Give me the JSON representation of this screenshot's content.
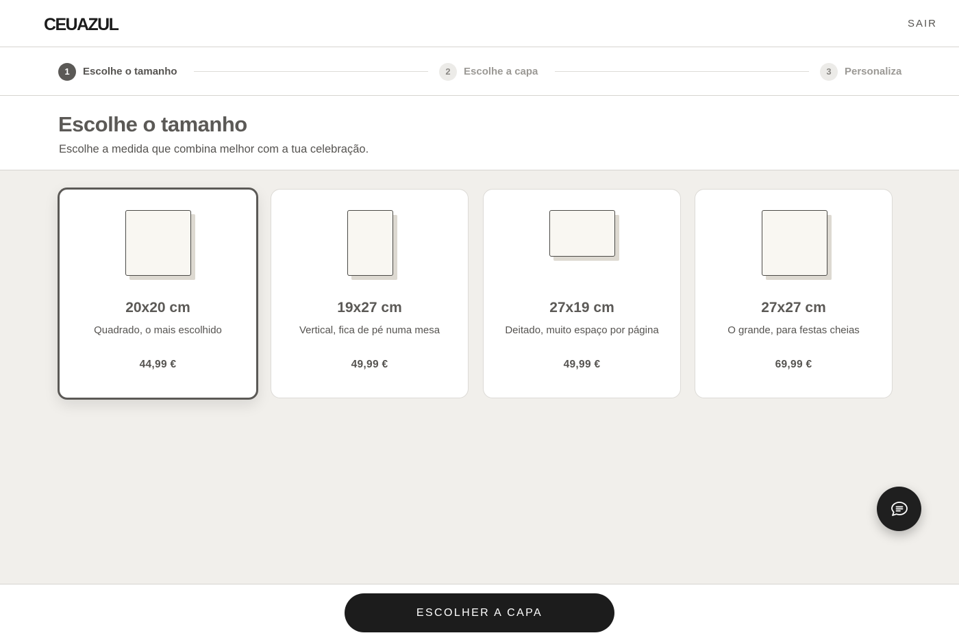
{
  "header": {
    "logo": "CEUAZUL",
    "exit_label": "SAIR"
  },
  "stepper": {
    "steps": [
      {
        "number": "1",
        "label": "Escolhe o tamanho",
        "state": "active"
      },
      {
        "number": "2",
        "label": "Escolhe a capa",
        "state": "inactive"
      },
      {
        "number": "3",
        "label": "Personaliza",
        "state": "inactive"
      }
    ]
  },
  "intro": {
    "title": "Escolhe o tamanho",
    "subtitle": "Escolhe a medida que combina melhor com a tua celebração."
  },
  "sizes": [
    {
      "size": "20x20 cm",
      "description": "Quadrado, o mais escolhido",
      "price": "44,99 €",
      "selected": true,
      "orientation": "square"
    },
    {
      "size": "19x27 cm",
      "description": "Vertical, fica de pé numa mesa",
      "price": "49,99 €",
      "selected": false,
      "orientation": "portrait"
    },
    {
      "size": "27x19 cm",
      "description": "Deitado, muito espaço por página",
      "price": "49,99 €",
      "selected": false,
      "orientation": "landscape"
    },
    {
      "size": "27x27 cm",
      "description": "O grande, para festas cheias",
      "price": "69,99 €",
      "selected": false,
      "orientation": "square"
    }
  ],
  "chat": {
    "icon": "chat-bubble-icon"
  },
  "footer": {
    "cta_label": "ESCOLHER A CAPA"
  },
  "colors": {
    "accent": "#1c1c1c",
    "selected_border": "#5b5956",
    "content_background": "#f1efeb"
  }
}
